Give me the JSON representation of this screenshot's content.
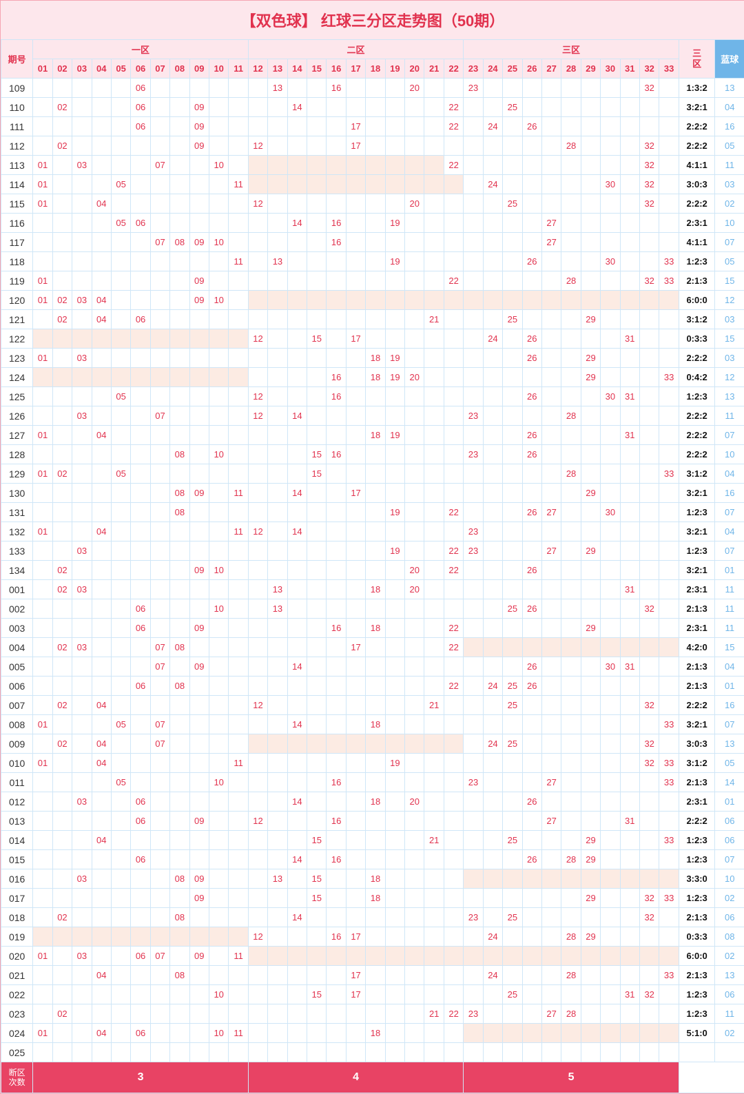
{
  "title": "【双色球】 红球三分区走势图（50期）",
  "header": {
    "period": "期号",
    "zones": [
      "一区",
      "二区",
      "三区"
    ],
    "cols_z1": [
      "01",
      "02",
      "03",
      "04",
      "05",
      "06",
      "07",
      "08",
      "09",
      "10",
      "11"
    ],
    "cols_z2": [
      "12",
      "13",
      "14",
      "15",
      "16",
      "17",
      "18",
      "19",
      "20",
      "21",
      "22"
    ],
    "cols_z3": [
      "23",
      "24",
      "25",
      "26",
      "27",
      "28",
      "29",
      "30",
      "31",
      "32",
      "33"
    ],
    "ratio": "三\n区",
    "blue": "蓝球"
  },
  "footer": {
    "label": "断区\n次数",
    "counts": [
      "3",
      "4",
      "5"
    ]
  },
  "chart_data": {
    "type": "table",
    "title": "红球三分区走势图（50期）",
    "columns": [
      "period",
      "red_balls",
      "none_zones",
      "ratio",
      "blue"
    ],
    "rows": [
      {
        "p": "109",
        "r": [
          6,
          13,
          16,
          20,
          23,
          32
        ],
        "nz": [],
        "ratio": "1:3:2",
        "b": "13"
      },
      {
        "p": "110",
        "r": [
          2,
          6,
          9,
          14,
          22,
          25
        ],
        "nz": [],
        "ratio": "3:2:1",
        "b": "04"
      },
      {
        "p": "111",
        "r": [
          6,
          9,
          17,
          22,
          24,
          26
        ],
        "nz": [],
        "ratio": "2:2:2",
        "b": "16"
      },
      {
        "p": "112",
        "r": [
          2,
          9,
          12,
          17,
          28,
          32
        ],
        "nz": [],
        "ratio": "2:2:2",
        "b": "05"
      },
      {
        "p": "113",
        "r": [
          1,
          3,
          7,
          10,
          22,
          32
        ],
        "nz": [
          2
        ],
        "ratio": "4:1:1",
        "b": "11"
      },
      {
        "p": "114",
        "r": [
          1,
          5,
          11,
          24,
          30,
          32
        ],
        "nz": [
          2
        ],
        "ratio": "3:0:3",
        "b": "03"
      },
      {
        "p": "115",
        "r": [
          1,
          4,
          12,
          20,
          25,
          32
        ],
        "nz": [],
        "ratio": "2:2:2",
        "b": "02"
      },
      {
        "p": "116",
        "r": [
          5,
          6,
          14,
          16,
          19,
          27
        ],
        "nz": [],
        "ratio": "2:3:1",
        "b": "10"
      },
      {
        "p": "117",
        "r": [
          7,
          8,
          9,
          10,
          16,
          27
        ],
        "nz": [],
        "ratio": "4:1:1",
        "b": "07"
      },
      {
        "p": "118",
        "r": [
          11,
          13,
          19,
          26,
          30,
          33
        ],
        "nz": [],
        "ratio": "1:2:3",
        "b": "05"
      },
      {
        "p": "119",
        "r": [
          1,
          9,
          22,
          28,
          32,
          33
        ],
        "nz": [],
        "ratio": "2:1:3",
        "b": "15"
      },
      {
        "p": "120",
        "r": [
          1,
          2,
          3,
          4,
          9,
          10
        ],
        "nz": [
          2,
          3
        ],
        "ratio": "6:0:0",
        "b": "12"
      },
      {
        "p": "121",
        "r": [
          2,
          4,
          6,
          21,
          25,
          29
        ],
        "nz": [],
        "ratio": "3:1:2",
        "b": "03"
      },
      {
        "p": "122",
        "r": [
          12,
          15,
          17,
          24,
          26,
          31
        ],
        "nz": [
          1
        ],
        "ratio": "0:3:3",
        "b": "15"
      },
      {
        "p": "123",
        "r": [
          1,
          3,
          18,
          19,
          26,
          29
        ],
        "nz": [],
        "ratio": "2:2:2",
        "b": "03"
      },
      {
        "p": "124",
        "r": [
          16,
          18,
          19,
          20,
          29,
          33
        ],
        "nz": [
          1
        ],
        "ratio": "0:4:2",
        "b": "12"
      },
      {
        "p": "125",
        "r": [
          5,
          12,
          16,
          26,
          30,
          31
        ],
        "nz": [],
        "ratio": "1:2:3",
        "b": "13"
      },
      {
        "p": "126",
        "r": [
          3,
          7,
          12,
          14,
          23,
          28
        ],
        "nz": [],
        "ratio": "2:2:2",
        "b": "11"
      },
      {
        "p": "127",
        "r": [
          1,
          4,
          18,
          19,
          26,
          31
        ],
        "nz": [],
        "ratio": "2:2:2",
        "b": "07"
      },
      {
        "p": "128",
        "r": [
          8,
          10,
          15,
          16,
          23,
          26
        ],
        "nz": [],
        "ratio": "2:2:2",
        "b": "10"
      },
      {
        "p": "129",
        "r": [
          1,
          2,
          5,
          15,
          28,
          33
        ],
        "nz": [],
        "ratio": "3:1:2",
        "b": "04"
      },
      {
        "p": "130",
        "r": [
          8,
          9,
          11,
          14,
          17,
          29
        ],
        "nz": [],
        "ratio": "3:2:1",
        "b": "16"
      },
      {
        "p": "131",
        "r": [
          8,
          19,
          22,
          26,
          27,
          30
        ],
        "nz": [],
        "ratio": "1:2:3",
        "b": "07"
      },
      {
        "p": "132",
        "r": [
          1,
          4,
          11,
          12,
          14,
          23
        ],
        "nz": [],
        "ratio": "3:2:1",
        "b": "04"
      },
      {
        "p": "133",
        "r": [
          3,
          19,
          22,
          23,
          27,
          29
        ],
        "nz": [],
        "ratio": "1:2:3",
        "b": "07"
      },
      {
        "p": "134",
        "r": [
          2,
          9,
          10,
          20,
          22,
          26
        ],
        "nz": [],
        "ratio": "3:2:1",
        "b": "01"
      },
      {
        "p": "001",
        "r": [
          2,
          3,
          13,
          18,
          20,
          31
        ],
        "nz": [],
        "ratio": "2:3:1",
        "b": "11"
      },
      {
        "p": "002",
        "r": [
          6,
          10,
          13,
          25,
          26,
          32
        ],
        "nz": [],
        "ratio": "2:1:3",
        "b": "11"
      },
      {
        "p": "003",
        "r": [
          6,
          9,
          16,
          18,
          22,
          29
        ],
        "nz": [],
        "ratio": "2:3:1",
        "b": "11"
      },
      {
        "p": "004",
        "r": [
          2,
          3,
          7,
          8,
          17,
          22
        ],
        "nz": [
          3
        ],
        "ratio": "4:2:0",
        "b": "15"
      },
      {
        "p": "005",
        "r": [
          7,
          9,
          14,
          26,
          30,
          31
        ],
        "nz": [],
        "ratio": "2:1:3",
        "b": "04"
      },
      {
        "p": "006",
        "r": [
          6,
          8,
          22,
          24,
          25,
          26
        ],
        "nz": [],
        "ratio": "2:1:3",
        "b": "01"
      },
      {
        "p": "007",
        "r": [
          2,
          4,
          12,
          21,
          25,
          32
        ],
        "nz": [],
        "ratio": "2:2:2",
        "b": "16"
      },
      {
        "p": "008",
        "r": [
          1,
          5,
          7,
          14,
          18,
          33
        ],
        "nz": [],
        "ratio": "3:2:1",
        "b": "07"
      },
      {
        "p": "009",
        "r": [
          2,
          4,
          7,
          24,
          25,
          32
        ],
        "nz": [
          2
        ],
        "ratio": "3:0:3",
        "b": "13"
      },
      {
        "p": "010",
        "r": [
          1,
          4,
          11,
          19,
          32,
          33
        ],
        "nz": [],
        "ratio": "3:1:2",
        "b": "05"
      },
      {
        "p": "011",
        "r": [
          5,
          10,
          16,
          23,
          27,
          33
        ],
        "nz": [],
        "ratio": "2:1:3",
        "b": "14"
      },
      {
        "p": "012",
        "r": [
          3,
          6,
          14,
          18,
          20,
          26
        ],
        "nz": [],
        "ratio": "2:3:1",
        "b": "01"
      },
      {
        "p": "013",
        "r": [
          6,
          9,
          12,
          16,
          27,
          31
        ],
        "nz": [],
        "ratio": "2:2:2",
        "b": "06"
      },
      {
        "p": "014",
        "r": [
          4,
          15,
          21,
          25,
          29,
          33
        ],
        "nz": [],
        "ratio": "1:2:3",
        "b": "06"
      },
      {
        "p": "015",
        "r": [
          6,
          14,
          16,
          26,
          28,
          29
        ],
        "nz": [],
        "ratio": "1:2:3",
        "b": "07"
      },
      {
        "p": "016",
        "r": [
          3,
          8,
          9,
          13,
          15,
          18
        ],
        "nz": [
          3
        ],
        "ratio": "3:3:0",
        "b": "10"
      },
      {
        "p": "017",
        "r": [
          9,
          15,
          18,
          29,
          32,
          33
        ],
        "nz": [],
        "ratio": "1:2:3",
        "b": "02"
      },
      {
        "p": "018",
        "r": [
          2,
          8,
          14,
          23,
          25,
          32
        ],
        "nz": [],
        "ratio": "2:1:3",
        "b": "06"
      },
      {
        "p": "019",
        "r": [
          12,
          16,
          17,
          24,
          28,
          29
        ],
        "nz": [
          1
        ],
        "ratio": "0:3:3",
        "b": "08"
      },
      {
        "p": "020",
        "r": [
          1,
          3,
          6,
          7,
          9,
          11
        ],
        "nz": [
          2,
          3
        ],
        "ratio": "6:0:0",
        "b": "02"
      },
      {
        "p": "021",
        "r": [
          4,
          8,
          17,
          24,
          28,
          33
        ],
        "nz": [],
        "ratio": "2:1:3",
        "b": "13"
      },
      {
        "p": "022",
        "r": [
          10,
          15,
          17,
          25,
          31,
          32
        ],
        "nz": [],
        "ratio": "1:2:3",
        "b": "06"
      },
      {
        "p": "023",
        "r": [
          2,
          21,
          22,
          23,
          27,
          28
        ],
        "nz": [],
        "ratio": "1:2:3",
        "b": "11"
      },
      {
        "p": "024",
        "r": [
          1,
          4,
          6,
          10,
          11,
          18
        ],
        "nz": [
          3
        ],
        "ratio": "5:1:0",
        "b": "02"
      },
      {
        "p": "025",
        "r": [],
        "nz": [],
        "ratio": "",
        "b": ""
      }
    ]
  }
}
